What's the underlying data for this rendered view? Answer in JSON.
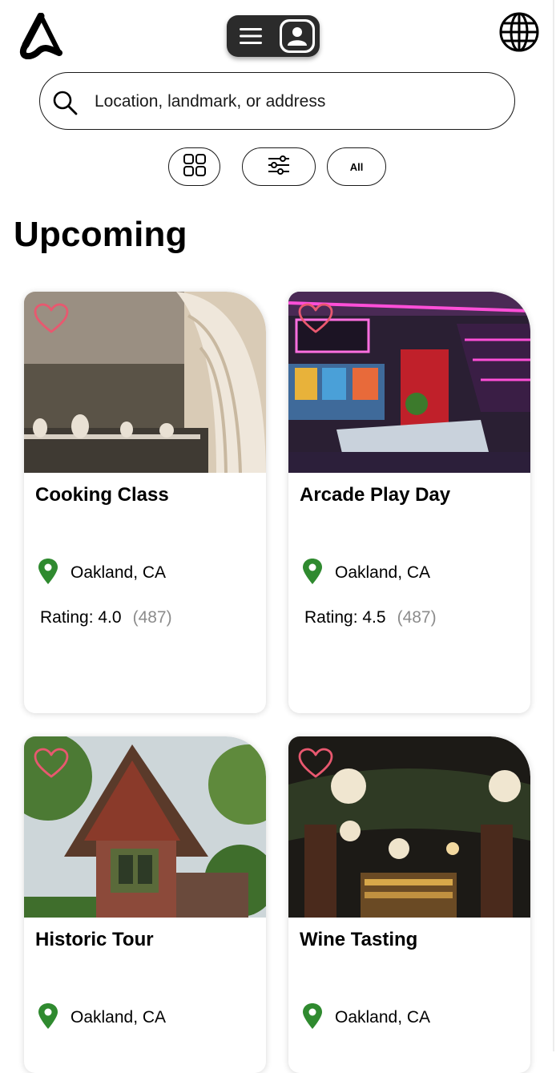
{
  "header": {
    "logo_icon": "app-logo-icon",
    "menu_icon": "hamburger-menu-icon",
    "profile_icon": "user-profile-icon",
    "language_icon": "globe-icon"
  },
  "search": {
    "placeholder": "Location, landmark, or address",
    "icon": "search-icon"
  },
  "filters": {
    "grid_icon": "grid-view-icon",
    "filter_icon": "sliders-icon",
    "all_label": "All"
  },
  "section": {
    "title": "Upcoming"
  },
  "colors": {
    "heart": "#e8586f",
    "pin": "#2f8a2f",
    "toggle_bg": "#2b2b2b",
    "muted_text": "#8c8c8c"
  },
  "cards": [
    {
      "title": "Cooking Class",
      "location": "Oakland, CA",
      "rating_label": "Rating: 4.0",
      "review_count": "(487)",
      "image": "restaurant-interior-photo"
    },
    {
      "title": "Arcade Play Day",
      "location": "Oakland, CA",
      "rating_label": "Rating: 4.5",
      "review_count": "(487)",
      "image": "arcade-room-photo"
    },
    {
      "title": "Historic Tour",
      "location": "Oakland, CA",
      "image": "victorian-house-photo"
    },
    {
      "title": "Wine Tasting",
      "location": "Oakland, CA",
      "image": "wine-bar-photo"
    }
  ]
}
